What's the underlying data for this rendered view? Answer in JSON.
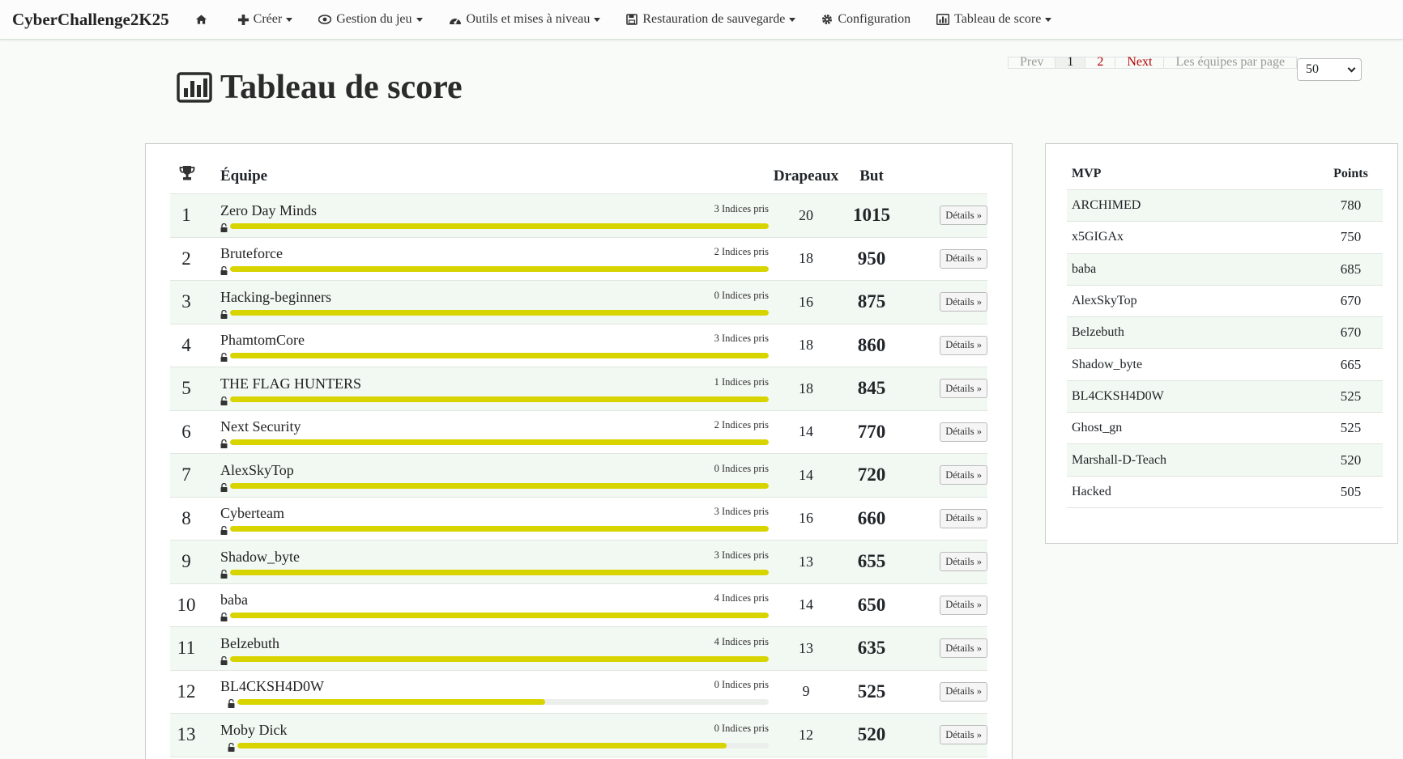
{
  "nav": {
    "brand": "CyberChallenge2K25",
    "items": [
      {
        "label": "Créer",
        "icon": "plus-icon",
        "dropdown": true
      },
      {
        "label": "Gestion du jeu",
        "icon": "eye-icon",
        "dropdown": true
      },
      {
        "label": "Outils et mises à niveau",
        "icon": "dashboard-icon",
        "dropdown": true
      },
      {
        "label": "Restauration de sauvegarde",
        "icon": "save-icon",
        "dropdown": true
      },
      {
        "label": "Configuration",
        "icon": "gear-icon",
        "dropdown": false
      },
      {
        "label": "Tableau de score",
        "icon": "bar-chart-icon",
        "dropdown": true
      }
    ]
  },
  "page": {
    "title": "Tableau de score"
  },
  "pagination": {
    "prev": "Prev",
    "pages": [
      "1",
      "2"
    ],
    "next": "Next",
    "per_page_label": "Les équipes par page",
    "per_page_value": "50"
  },
  "scoreboard": {
    "headers": {
      "team": "Équipe",
      "flags": "Drapeaux",
      "score": "But"
    },
    "details_label": "Détails »",
    "rows": [
      {
        "rank": "1",
        "team": "Zero Day Minds",
        "hints": "3 Indices pris",
        "flags": "20",
        "score": "1015",
        "progress": 1.0
      },
      {
        "rank": "2",
        "team": "Bruteforce",
        "hints": "2 Indices pris",
        "flags": "18",
        "score": "950",
        "progress": 1.0
      },
      {
        "rank": "3",
        "team": "Hacking-beginners",
        "hints": "0 Indices pris",
        "flags": "16",
        "score": "875",
        "progress": 1.0
      },
      {
        "rank": "4",
        "team": "PhamtomCore",
        "hints": "3 Indices pris",
        "flags": "18",
        "score": "860",
        "progress": 1.0
      },
      {
        "rank": "5",
        "team": "THE FLAG HUNTERS",
        "hints": "1 Indices pris",
        "flags": "18",
        "score": "845",
        "progress": 1.0
      },
      {
        "rank": "6",
        "team": "Next Security",
        "hints": "2 Indices pris",
        "flags": "14",
        "score": "770",
        "progress": 1.0
      },
      {
        "rank": "7",
        "team": "AlexSkyTop",
        "hints": "0 Indices pris",
        "flags": "14",
        "score": "720",
        "progress": 1.0
      },
      {
        "rank": "8",
        "team": "Cyberteam",
        "hints": "3 Indices pris",
        "flags": "16",
        "score": "660",
        "progress": 1.0
      },
      {
        "rank": "9",
        "team": "Shadow_byte",
        "hints": "3 Indices pris",
        "flags": "13",
        "score": "655",
        "progress": 1.0
      },
      {
        "rank": "10",
        "team": "baba",
        "hints": "4 Indices pris",
        "flags": "14",
        "score": "650",
        "progress": 1.0
      },
      {
        "rank": "11",
        "team": "Belzebuth",
        "hints": "4 Indices pris",
        "flags": "13",
        "score": "635",
        "progress": 1.0
      },
      {
        "rank": "12",
        "team": "BL4CKSH4D0W",
        "hints": "0 Indices pris",
        "flags": "9",
        "score": "525",
        "progress": 0.58
      },
      {
        "rank": "13",
        "team": "Moby Dick",
        "hints": "0 Indices pris",
        "flags": "12",
        "score": "520",
        "progress": 0.92
      }
    ]
  },
  "mvp": {
    "headers": {
      "name": "MVP",
      "points": "Points"
    },
    "rows": [
      {
        "name": "ARCHIMED",
        "points": "780"
      },
      {
        "name": "x5GIGAx",
        "points": "750"
      },
      {
        "name": "baba",
        "points": "685"
      },
      {
        "name": "AlexSkyTop",
        "points": "670"
      },
      {
        "name": "Belzebuth",
        "points": "670"
      },
      {
        "name": "Shadow_byte",
        "points": "665"
      },
      {
        "name": "BL4CKSH4D0W",
        "points": "525"
      },
      {
        "name": "Ghost_gn",
        "points": "525"
      },
      {
        "name": "Marshall-D-Teach",
        "points": "520"
      },
      {
        "name": "Hacked",
        "points": "505"
      }
    ]
  },
  "colors": {
    "progress_fill": "#d8d400",
    "link_red": "#b30000"
  }
}
